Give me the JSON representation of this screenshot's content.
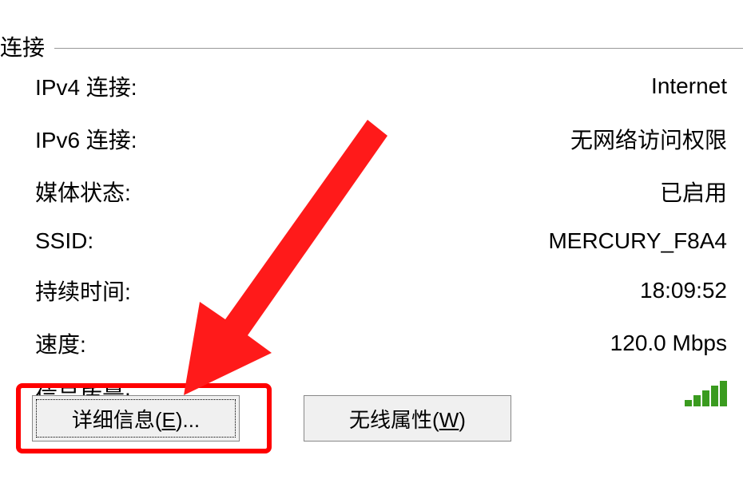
{
  "section": {
    "title": "连接"
  },
  "rows": {
    "ipv4": {
      "label": "IPv4 连接:",
      "value": "Internet"
    },
    "ipv6": {
      "label": "IPv6 连接:",
      "value": "无网络访问权限"
    },
    "media": {
      "label": "媒体状态:",
      "value": "已启用"
    },
    "ssid": {
      "label": "SSID:",
      "value": "MERCURY_F8A4"
    },
    "duration": {
      "label": "持续时间:",
      "value": "18:09:52"
    },
    "speed": {
      "label": "速度:",
      "value": "120.0 Mbps"
    },
    "signal": {
      "label": "信号质量:"
    }
  },
  "buttons": {
    "details_prefix": "详细信息(",
    "details_accel": "E",
    "details_suffix": ")...",
    "wireless_prefix": "无线属性(",
    "wireless_accel": "W",
    "wireless_suffix": ")"
  },
  "annotation": {
    "arrow_color": "#ff1a1a",
    "highlight_color": "#ff0000"
  }
}
